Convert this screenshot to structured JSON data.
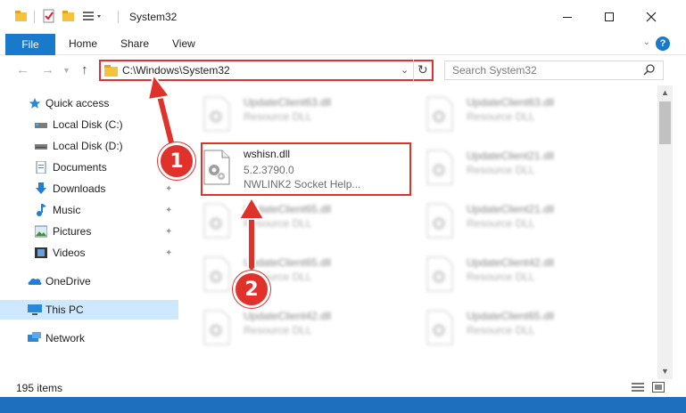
{
  "window": {
    "title": "System32",
    "minimize_icon": "minimize-icon",
    "maximize_icon": "maximize-icon",
    "close_icon": "close-icon"
  },
  "ribbon": {
    "tabs": [
      {
        "label": "File"
      },
      {
        "label": "Home"
      },
      {
        "label": "Share"
      },
      {
        "label": "View"
      }
    ],
    "help_label": "?"
  },
  "address": {
    "path": "C:\\Windows\\System32",
    "search_placeholder": "Search System32"
  },
  "nav_pane": {
    "items": [
      {
        "label": "Quick access",
        "icon": "star-icon",
        "pinned": false
      },
      {
        "label": "Local Disk (C:)",
        "icon": "drive-icon",
        "pinned": true
      },
      {
        "label": "Local Disk (D:)",
        "icon": "drive-icon",
        "pinned": true
      },
      {
        "label": "Documents",
        "icon": "documents-icon",
        "pinned": true
      },
      {
        "label": "Downloads",
        "icon": "downloads-icon",
        "pinned": true
      },
      {
        "label": "Music",
        "icon": "music-icon",
        "pinned": true
      },
      {
        "label": "Pictures",
        "icon": "pictures-icon",
        "pinned": true
      },
      {
        "label": "Videos",
        "icon": "videos-icon",
        "pinned": true
      },
      {
        "label": "OneDrive",
        "icon": "onedrive-icon",
        "pinned": false
      },
      {
        "label": "This PC",
        "icon": "this-pc-icon",
        "pinned": false,
        "selected": true
      },
      {
        "label": "Network",
        "icon": "network-icon",
        "pinned": false
      }
    ]
  },
  "files": {
    "highlighted": {
      "name": "wshisn.dll",
      "version": "5.2.3790.0",
      "description": "NWLINK2 Socket Help..."
    },
    "blurred": [
      {
        "name": "UpdateClient63.dll",
        "type": "Resource DLL"
      },
      {
        "name": "UpdateClient63.dll",
        "type": "Resource DLL"
      },
      {
        "name": "UpdateClient21.dll",
        "type": "Resource DLL"
      },
      {
        "name": "UpdateClient65.dll",
        "type": "Resource DLL"
      },
      {
        "name": "UpdateClient21.dll",
        "type": "Resource DLL"
      },
      {
        "name": "UpdateClient65.dll",
        "type": "Resource DLL"
      },
      {
        "name": "UpdateClient42.dll",
        "type": "Resource DLL"
      },
      {
        "name": "UpdateClient42.dll",
        "type": "Resource DLL"
      },
      {
        "name": "UpdateClient65.dll",
        "type": "Resource DLL"
      }
    ]
  },
  "status": {
    "item_count": "195 items"
  },
  "annotations": {
    "step1": "1",
    "step2": "2",
    "accent_color": "#e0312b"
  }
}
